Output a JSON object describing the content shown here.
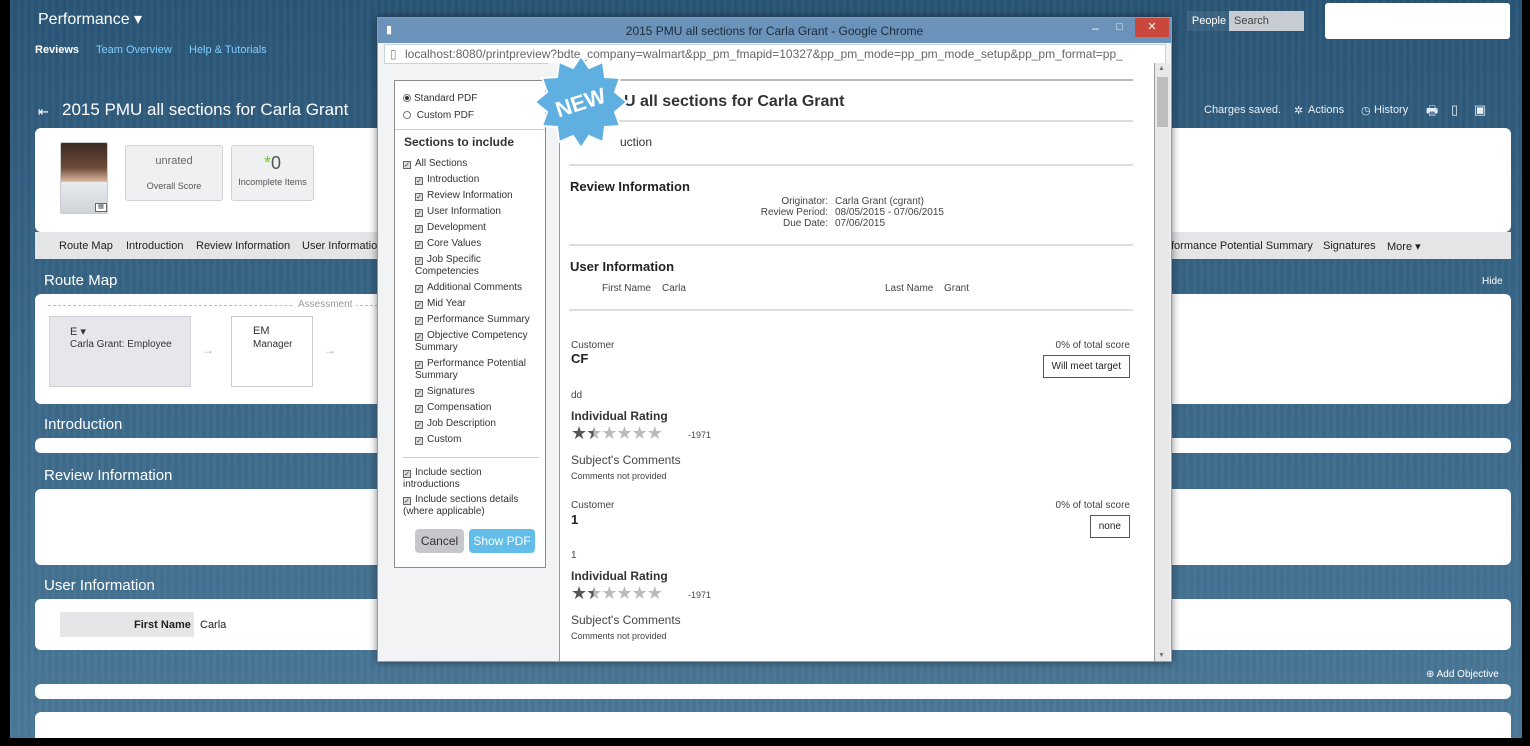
{
  "app": {
    "title": "Performance ▾",
    "subnav": [
      "Reviews",
      "Team Overview",
      "Help & Tutorials"
    ],
    "people": "People",
    "search_placeholder": "Search",
    "page_title": "2015 PMU all sections for Carla Grant",
    "status": "Charges saved.",
    "actions": "Actions",
    "history": "History"
  },
  "summary": {
    "rating": "unrated",
    "overall_score": "Overall Score",
    "incomplete_count": "0",
    "incomplete_label": "Incomplete Items"
  },
  "tabs": [
    "Route Map",
    "Introduction",
    "Review Information",
    "User Informatio",
    "formance Potential Summary",
    "Signatures",
    "More ▾"
  ],
  "route_map": {
    "title": "Route Map",
    "hide": "Hide",
    "stage": "Assessment",
    "steps": [
      {
        "code": "E ▾",
        "label": "Carla Grant: Employee"
      },
      {
        "code": "EM",
        "label": "Manager"
      }
    ]
  },
  "sections": {
    "introduction": "Introduction",
    "review_information": "Review Information",
    "user_information": "User Information",
    "first_name_label": "First Name",
    "first_name_value": "Carla",
    "add_objective": "Add Objective"
  },
  "modal": {
    "title": "2015 PMU all sections for Carla Grant - Google Chrome",
    "url": "localhost:8080/printpreview?bdte_company=walmart&pp_pm_fmapid=10327&pp_pm_mode=pp_pm_mode_setup&pp_pm_format=pp_",
    "badge": "NEW",
    "pdf_options": [
      "Standard PDF",
      "Custom PDF"
    ],
    "sections_heading": "Sections to include",
    "all_sections": "All Sections",
    "section_items": [
      "Introduction",
      "Review Information",
      "User Information",
      "Development",
      "Core Values",
      "Job Specific Competencies",
      "Additional Comments",
      "Mid Year",
      "Performance Summary",
      "Objective Competency Summary",
      "Performance Potential Summary",
      "Signatures",
      "Compensation",
      "Job Description",
      "Custom"
    ],
    "include_intros": "Include section introductions",
    "include_details": "Include sections details (where applicable)",
    "cancel": "Cancel",
    "show_pdf": "Show PDF"
  },
  "preview": {
    "title": "2015 PMU all sections for Carla Grant",
    "title_visible": "U all sections for Carla Grant",
    "intro_visible": "uction",
    "review_info_heading": "Review Information",
    "originator_label": "Originator:",
    "originator_value": "Carla Grant (cgrant)",
    "period_label": "Review Period:",
    "period_value": "08/05/2015 - 07/06/2015",
    "due_label": "Due Date:",
    "due_value": "07/06/2015",
    "user_info_heading": "User Information",
    "first_name_label": "First Name",
    "first_name_value": "Carla",
    "last_name_label": "Last Name",
    "last_name_value": "Grant",
    "items": [
      {
        "category": "Customer",
        "name": "CF",
        "pct": "0% of total score",
        "target": "Will meet target",
        "desc": "dd",
        "rating_label": "Individual Rating",
        "rating_value": "-1971",
        "comments_label": "Subject's Comments",
        "comments": "Comments not provided"
      },
      {
        "category": "Customer",
        "name": "1",
        "pct": "0% of total score",
        "target": "none",
        "desc": "1",
        "rating_label": "Individual Rating",
        "rating_value": "-1971",
        "comments_label": "Subject's Comments",
        "comments": "Comments not provided"
      }
    ]
  }
}
